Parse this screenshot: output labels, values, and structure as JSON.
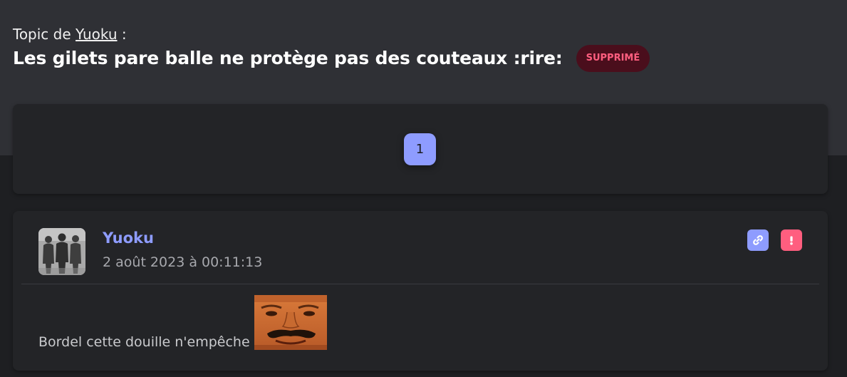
{
  "header": {
    "topic_prefix": "Topic de",
    "author_link": "Yuoku",
    "topic_suffix": " :",
    "title": "Les gilets pare balle ne protège pas des couteaux :rire:",
    "badge": "SUPPRIMÉ"
  },
  "pagination": {
    "current_page": "1"
  },
  "post": {
    "author": "Yuoku",
    "date": "2 août 2023 à 00:11:13",
    "text": "Bordel cette douille n'empêche",
    "icons": [
      "link-icon",
      "report-icon"
    ]
  },
  "colors": {
    "accent": "#8e9cff",
    "danger": "#ff5e7f",
    "badge_bg": "#4a0e1c",
    "card_bg": "#232427"
  }
}
